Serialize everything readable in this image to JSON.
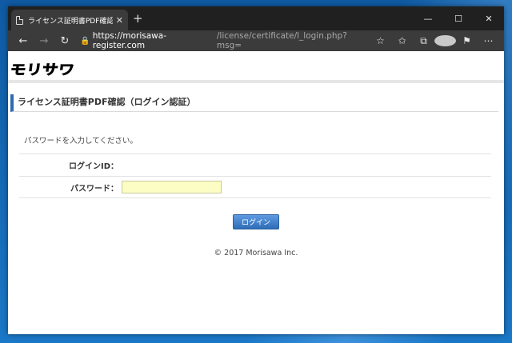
{
  "browser": {
    "tab_title": "ライセンス証明書PDF確認（ログイン",
    "tab_close": "✕",
    "new_tab": "+",
    "controls": {
      "minimize": "—",
      "maximize": "☐",
      "close": "✕"
    },
    "url_host": "https://morisawa-register.com",
    "url_path": "/license/certificate/l_login.php?msg="
  },
  "site": {
    "logo": "モリサワ",
    "heading": "ライセンス証明書PDF確認（ログイン認証）",
    "instructions": "パスワードを入力してください。",
    "login_id_label": "ログインID：",
    "login_id_value": "",
    "password_label": "パスワード：",
    "password_value": "",
    "login_button": "ログイン",
    "footer": "© 2017 Morisawa Inc."
  },
  "colors": {
    "accent": "#2e6bb0",
    "input_bg": "#fbfdc4"
  }
}
